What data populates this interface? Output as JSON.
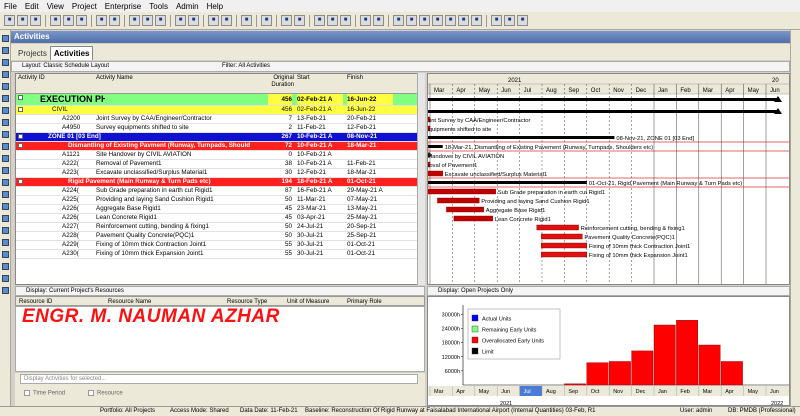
{
  "menu": [
    "File",
    "Edit",
    "View",
    "Project",
    "Enterprise",
    "Tools",
    "Admin",
    "Help"
  ],
  "panel_title": "Activities",
  "tabs": [
    "Projects",
    "Activities"
  ],
  "layout_label": "Layout: Classic Schedule Layout",
  "filter_label": "Filter: All Activities",
  "columns": {
    "id": "Activity ID",
    "name": "Activity Name",
    "dur": "Original Duration",
    "start": "Start",
    "finish": "Finish"
  },
  "rows": [
    {
      "id": "EXECUTION PHASE",
      "name": "",
      "dur": "456",
      "start": "02-Feb-21 A",
      "finish": "16-Jun-22",
      "type": "phase"
    },
    {
      "id": "CIVIL",
      "name": "",
      "dur": "456",
      "start": "02-Feb-21 A",
      "finish": "16-Jun-22",
      "type": "civil"
    },
    {
      "id": "A2200",
      "name": "Joint Survey by CAA/Engineer/Contractor",
      "dur": "7",
      "start": "13-Feb-21",
      "finish": "20-Feb-21",
      "type": "act"
    },
    {
      "id": "A4950",
      "name": "Survey equipments shifted to site",
      "dur": "2",
      "start": "11-Feb-21",
      "finish": "12-Feb-21",
      "type": "act"
    },
    {
      "id": "ZONE 01 [03 End]",
      "name": "",
      "dur": "267",
      "start": "10-Feb-21 A",
      "finish": "08-Nov-21",
      "type": "zone"
    },
    {
      "id": "Dismantling of Existing Pavment (Runway, Turnpads, Should",
      "name": "",
      "dur": "72",
      "start": "10-Feb-21 A",
      "finish": "18-Mar-21",
      "type": "red"
    },
    {
      "id": "A1121",
      "name": "Site Handover by CIVIL AVIATION",
      "dur": "0",
      "start": "10-Feb-21 A",
      "finish": "",
      "type": "act"
    },
    {
      "id": "A222(",
      "name": "Removal of Pavement1",
      "dur": "38",
      "start": "10-Feb-21 A",
      "finish": "11-Feb-21",
      "type": "act"
    },
    {
      "id": "A223(",
      "name": "Excavate unclassified/Surplus Material1",
      "dur": "30",
      "start": "12-Feb-21",
      "finish": "18-Mar-21",
      "type": "act"
    },
    {
      "id": "Rigid Pavement (Main Runway & Turn Pads etc)",
      "name": "",
      "dur": "194",
      "start": "18-Feb-21 A",
      "finish": "01-Oct-21",
      "type": "red"
    },
    {
      "id": "A224(",
      "name": "Sub Grade preparation in earth cut Rigid1",
      "dur": "87",
      "start": "16-Feb-21 A",
      "finish": "29-May-21 A",
      "type": "act"
    },
    {
      "id": "A225(",
      "name": "Providing and laying Sand Cushion Rigid1",
      "dur": "50",
      "start": "11-Mar-21",
      "finish": "07-May-21",
      "type": "act"
    },
    {
      "id": "A226(",
      "name": "Aggregate Base Rigid1",
      "dur": "45",
      "start": "23-Mar-21",
      "finish": "13-May-21",
      "type": "act"
    },
    {
      "id": "A226(",
      "name": "Lean Concrete Rigid1",
      "dur": "45",
      "start": "03-Apr-21",
      "finish": "25-May-21",
      "type": "act"
    },
    {
      "id": "A227(",
      "name": "Reinforcement cutting, bending & fixing1",
      "dur": "50",
      "start": "24-Jul-21",
      "finish": "20-Sep-21",
      "type": "act"
    },
    {
      "id": "A228(",
      "name": "Pavement Quality Concrete(PQC)1",
      "dur": "50",
      "start": "30-Jul-21",
      "finish": "25-Sep-21",
      "type": "act"
    },
    {
      "id": "A229(",
      "name": "Fixing of 10mm thick Contraction Joint1",
      "dur": "55",
      "start": "30-Jul-21",
      "finish": "01-Oct-21",
      "type": "act"
    },
    {
      "id": "A230(",
      "name": "Fixing of 10mm thick Expansion Joint1",
      "dur": "55",
      "start": "30-Jul-21",
      "finish": "01-Oct-21",
      "type": "act"
    }
  ],
  "gantt": {
    "year_left": "2021",
    "year_right": "20",
    "months": [
      "Mar",
      "Apr",
      "May",
      "Jun",
      "Jul",
      "Aug",
      "Sep",
      "Oct",
      "Nov",
      "Dec",
      "Jan",
      "Feb",
      "Mar",
      "Apr",
      "May",
      "Jun"
    ],
    "labels": [
      "",
      "",
      "Joint Survey by CAA/Engineer/Contractor",
      "ey equipments shifted to site",
      "08-Nov-21, ZONE 01 [03 End]",
      "18-Mar-21, Dismantling of Existing Pavement (Runway, Turnpads, Shoulders etc)",
      "Handover by CIVIL AVIATION",
      "Removal of Pavement1",
      "Excavate unclassified/Surplus Material1",
      "01-Oct-21, Rigid Pavement (Main Runway & Turn Pads etc)",
      "Sub Grade preparation in earth cut Rigid1",
      "Providing and laying Sand Cushion Rigid1",
      "Aggregate Base Rigid1",
      "Lean Concrete Rigid1",
      "Reinforcement cutting, bending & fixing1",
      "Pavement Quality Concrete(PQC)1",
      "Fixing of 10mm thick Contraction Joint1",
      "Fixing of 10mm thick Expansion Joint1"
    ]
  },
  "resources": {
    "bar_label": "Display: Current Project's Resources",
    "columns": [
      "Resource ID",
      "Resource Name",
      "Resource Type",
      "Unit of Measure",
      "Primary Role"
    ],
    "select_text": "Display Activities for selected...",
    "check1": "Time Period",
    "check2": "Resource"
  },
  "watermark": "ENGR. M. NAUMAN AZHAR",
  "open_projects_label": "Display: Open Projects Only",
  "chart_data": {
    "type": "bar",
    "title": "",
    "yticks": [
      "30000h",
      "24000h",
      "18000h",
      "12000h",
      "6000h"
    ],
    "ylim": [
      0,
      34000
    ],
    "legend": [
      "Actual Units",
      "Remaining Early Units",
      "Overallocated Early Units",
      "Limit"
    ],
    "legend_colors": [
      "#0000ff",
      "#80ff80",
      "#ff0000",
      "#000000"
    ],
    "months": [
      "Mar",
      "Apr",
      "May",
      "Jun",
      "Jul",
      "Aug",
      "Sep",
      "Oct",
      "Nov",
      "Dec",
      "Jan",
      "Feb",
      "Mar",
      "Apr",
      "May",
      "Jun"
    ],
    "highlight_month": "Jul",
    "year_left": "2021",
    "year_right": "2022",
    "values": [
      0,
      0,
      0,
      0,
      0,
      0,
      500,
      9500,
      10000,
      14500,
      25500,
      27500,
      17000,
      10000,
      0,
      0
    ]
  },
  "status": {
    "portfolio": "Portfolio: All Projects",
    "access": "Access Mode: Shared",
    "datadate": "Data Date: 11-Feb-21",
    "baseline": "Baseline: Reconstruction Of Rigid Runway at Faisalabad International Airport (Internal Quantities) 03-Feb, R1",
    "user": "User: admin",
    "db": "DB: PMDB (Professional)"
  }
}
